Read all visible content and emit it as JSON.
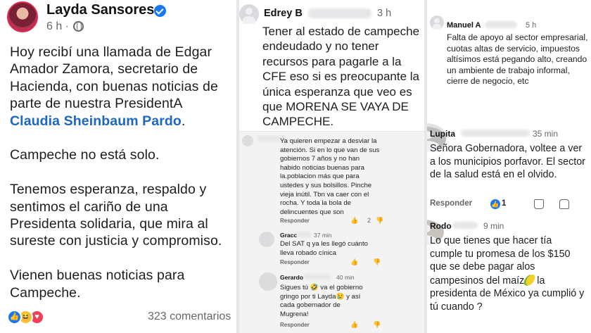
{
  "post": {
    "author": "Layda Sansores",
    "time": "6 h ·",
    "paragraphs": [
      "Hoy recibí una llamada de Edgar Amador Zamora, secretario de Hacienda, con buenas noticias de parte de nuestra PresidentA",
      "Claudia Sheinbaum Pardo",
      "Campeche no está solo.",
      "Tenemos esperanza, respaldo y sentimos el cariño de una Presidenta solidaria, que mira al sureste con justicia y compromiso.",
      "Vienen buenas noticias para Campeche."
    ],
    "mention_suffix": ".",
    "reactions": [
      "like-icon",
      "haha-icon",
      "love-icon"
    ],
    "comments_count": "323 comentarios"
  },
  "panel2": {
    "main": {
      "name": "Edrey B",
      "time": "3 h",
      "text": "Tener al estado de campeche endeudado y no tener recursos para pagarle a la CFE eso si es preocupante la única esperanza que veo es que MORENA SE VAYA DE CAMPECHE."
    },
    "sub": [
      {
        "name": "",
        "time": "",
        "text": "Ya quieren empezar a desviar la atención. Si en lo que van de sus gobiernos 7 años y no han habido noticias buenas para la.poblacion más que para ustedes y sus bolsillos. Pinche vieja inútil. Tbn va caer con el rocha. Y toda la bola de delincuentes que son",
        "reply": "Responder",
        "likes": "2"
      },
      {
        "name": "Gracc",
        "time": "37 min",
        "text": "Del SAT q ya les llegó cuánto lleva robado cínica",
        "reply": "Responder",
        "likes": ""
      },
      {
        "name": "Gerardo",
        "time": "40 min",
        "text": "Sigues tú 🤣 va el gobierno gringo por ti Layda😢 y así cada gobernador de Mugrena!",
        "reply": "Responder",
        "likes": ""
      }
    ]
  },
  "panel3": {
    "comments": [
      {
        "name": "Manuel A",
        "time": "5 h",
        "text": "Falta de apoyo al sector empresarial, cuotas altas de servicio, impuestos altísimos está pegando alto, creando un ambiente de trabajo informal, cierre de negocio, etc"
      },
      {
        "name": "Lupita",
        "time": "35 min",
        "text": "Señora Gobernadora, voltee a ver a los municipios porfavor. El sector de la salud está en el olvido.",
        "reply": "Responder",
        "likes": "1"
      },
      {
        "name": "Rodo",
        "time": "9 min",
        "text_a": "Lo que tienes que hacer tía cumple tu promesa de los $150 que se debe pagar alos campesinos del maíz",
        "text_b": "la presidenta de México ya cumplió y tú cuando ?"
      }
    ]
  }
}
